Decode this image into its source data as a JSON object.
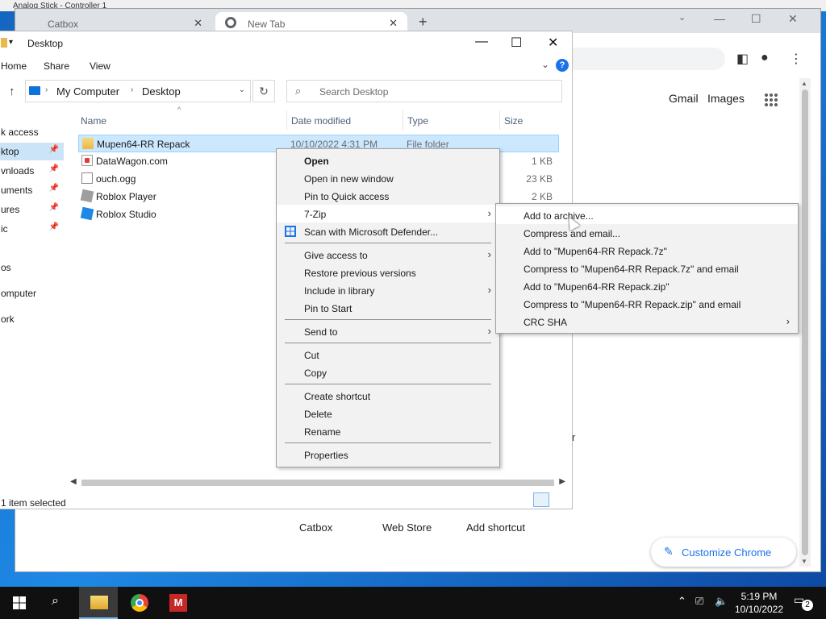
{
  "background_window": {
    "title": "Analog Stick - Controller 1"
  },
  "chrome": {
    "tabs": [
      {
        "label": "Catbox"
      },
      {
        "label": "New Tab"
      }
    ],
    "new_tab_symbol": "+",
    "links": {
      "gmail": "Gmail",
      "images": "Images"
    },
    "shortcuts": [
      "Catbox",
      "Web Store",
      "Add shortcut"
    ],
    "customize_label": "Customize Chrome",
    "stray_text": "r"
  },
  "explorer": {
    "title": "Desktop",
    "ribbon": {
      "file": "Home",
      "share": "Share",
      "view": "View"
    },
    "address": {
      "root": "My Computer",
      "current": "Desktop"
    },
    "search_placeholder": "Search Desktop",
    "columns": {
      "name": "Name",
      "date": "Date modified",
      "type": "Type",
      "size": "Size"
    },
    "nav_items": [
      {
        "label": "k access",
        "pinned": false
      },
      {
        "label": "ktop",
        "pinned": true
      },
      {
        "label": "vnloads",
        "pinned": true
      },
      {
        "label": "uments",
        "pinned": true
      },
      {
        "label": "ures",
        "pinned": true
      },
      {
        "label": "ic",
        "pinned": true
      },
      {
        "label": "os",
        "pinned": false
      },
      {
        "label": "omputer",
        "pinned": false
      },
      {
        "label": "ork",
        "pinned": false
      }
    ],
    "files": [
      {
        "name": "Mupen64-RR Repack",
        "date": "10/10/2022 4:31 PM",
        "type": "File folder",
        "size": "",
        "icon": "folder-icon"
      },
      {
        "name": "DataWagon.com",
        "date": "",
        "type": "",
        "size": "1 KB",
        "icon": "web-shortcut-icon"
      },
      {
        "name": "ouch.ogg",
        "date": "",
        "type": "",
        "size": "23 KB",
        "icon": "file-icon"
      },
      {
        "name": "Roblox Player",
        "date": "",
        "type": "",
        "size": "2 KB",
        "icon": "roblox-icon"
      },
      {
        "name": "Roblox Studio",
        "date": "",
        "type": "",
        "size": "",
        "icon": "roblox-studio-icon"
      }
    ],
    "status": "1 item selected"
  },
  "context_menu": {
    "items": [
      {
        "label": "Open"
      },
      {
        "label": "Open in new window"
      },
      {
        "label": "Pin to Quick access"
      },
      {
        "label": "7-Zip"
      },
      {
        "label": "Scan with Microsoft Defender..."
      },
      {
        "label": "Give access to"
      },
      {
        "label": "Restore previous versions"
      },
      {
        "label": "Include in library"
      },
      {
        "label": "Pin to Start"
      },
      {
        "label": "Send to"
      },
      {
        "label": "Cut"
      },
      {
        "label": "Copy"
      },
      {
        "label": "Create shortcut"
      },
      {
        "label": "Delete"
      },
      {
        "label": "Rename"
      },
      {
        "label": "Properties"
      }
    ]
  },
  "submenu_7zip": {
    "items": [
      {
        "label": "Add to archive..."
      },
      {
        "label": "Compress and email..."
      },
      {
        "label": "Add to \"Mupen64-RR Repack.7z\""
      },
      {
        "label": "Compress to \"Mupen64-RR Repack.7z\" and email"
      },
      {
        "label": "Add to \"Mupen64-RR Repack.zip\""
      },
      {
        "label": "Compress to \"Mupen64-RR Repack.zip\" and email"
      },
      {
        "label": "CRC SHA"
      }
    ]
  },
  "taskbar": {
    "time": "5:19 PM",
    "date": "10/10/2022",
    "notification_count": "2",
    "mupen_glyph": "M"
  }
}
